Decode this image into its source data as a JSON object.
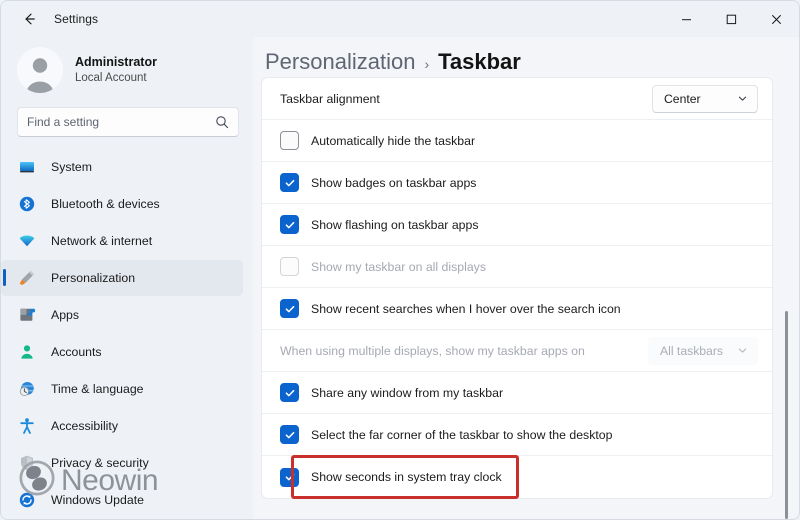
{
  "window": {
    "app_title": "Settings",
    "back_icon": "back-arrow-icon",
    "controls": {
      "minimize": "minimize-icon",
      "maximize": "maximize-icon",
      "close": "close-icon"
    }
  },
  "sidebar": {
    "account": {
      "name": "Administrator",
      "subtitle": "Local Account",
      "avatar_icon": "user-avatar-icon"
    },
    "search": {
      "placeholder": "Find a setting",
      "value": "",
      "icon": "search-icon"
    },
    "items": [
      {
        "label": "System",
        "icon": "monitor-icon",
        "active": false
      },
      {
        "label": "Bluetooth & devices",
        "icon": "bluetooth-icon",
        "active": false
      },
      {
        "label": "Network & internet",
        "icon": "wifi-icon",
        "active": false
      },
      {
        "label": "Personalization",
        "icon": "paintbrush-icon",
        "active": true
      },
      {
        "label": "Apps",
        "icon": "apps-icon",
        "active": false
      },
      {
        "label": "Accounts",
        "icon": "accounts-icon",
        "active": false
      },
      {
        "label": "Time & language",
        "icon": "clock-globe-icon",
        "active": false
      },
      {
        "label": "Accessibility",
        "icon": "accessibility-icon",
        "active": false
      },
      {
        "label": "Privacy & security",
        "icon": "shield-icon",
        "active": false
      },
      {
        "label": "Windows Update",
        "icon": "update-icon",
        "active": false
      }
    ],
    "watermark": {
      "text": "Neowin",
      "icon": "neowin-logo-icon"
    }
  },
  "main": {
    "breadcrumb": {
      "parent": "Personalization",
      "separator": "›",
      "current": "Taskbar"
    },
    "rows": [
      {
        "label": "Taskbar alignment",
        "control": "dropdown",
        "value": "Center",
        "disabled": false,
        "highlighted": false
      },
      {
        "label": "Automatically hide the taskbar",
        "control": "checkbox",
        "checked": false,
        "disabled": false,
        "highlighted": false
      },
      {
        "label": "Show badges on taskbar apps",
        "control": "checkbox",
        "checked": true,
        "disabled": false,
        "highlighted": false
      },
      {
        "label": "Show flashing on taskbar apps",
        "control": "checkbox",
        "checked": true,
        "disabled": false,
        "highlighted": false
      },
      {
        "label": "Show my taskbar on all displays",
        "control": "checkbox",
        "checked": false,
        "disabled": true,
        "highlighted": false
      },
      {
        "label": "Show recent searches when I hover over the search icon",
        "control": "checkbox",
        "checked": true,
        "disabled": false,
        "highlighted": false
      },
      {
        "label": "When using multiple displays, show my taskbar apps on",
        "control": "dropdown",
        "value": "All taskbars",
        "disabled": true,
        "highlighted": false
      },
      {
        "label": "Share any window from my taskbar",
        "control": "checkbox",
        "checked": true,
        "disabled": false,
        "highlighted": false
      },
      {
        "label": "Select the far corner of the taskbar to show the desktop",
        "control": "checkbox",
        "checked": true,
        "disabled": false,
        "highlighted": false
      },
      {
        "label": "Show seconds in system tray clock",
        "control": "checkbox",
        "checked": true,
        "disabled": false,
        "highlighted": true
      }
    ],
    "scrollbar": {
      "thumb_top_pct": 52,
      "thumb_height_pct": 48
    }
  },
  "colors": {
    "accent": "#0b63ce",
    "highlight": "#c9302c",
    "sidebar_bg": "#eef2f7",
    "card_bg": "#ffffff",
    "active_nav_bar": "#0f5fc2"
  }
}
